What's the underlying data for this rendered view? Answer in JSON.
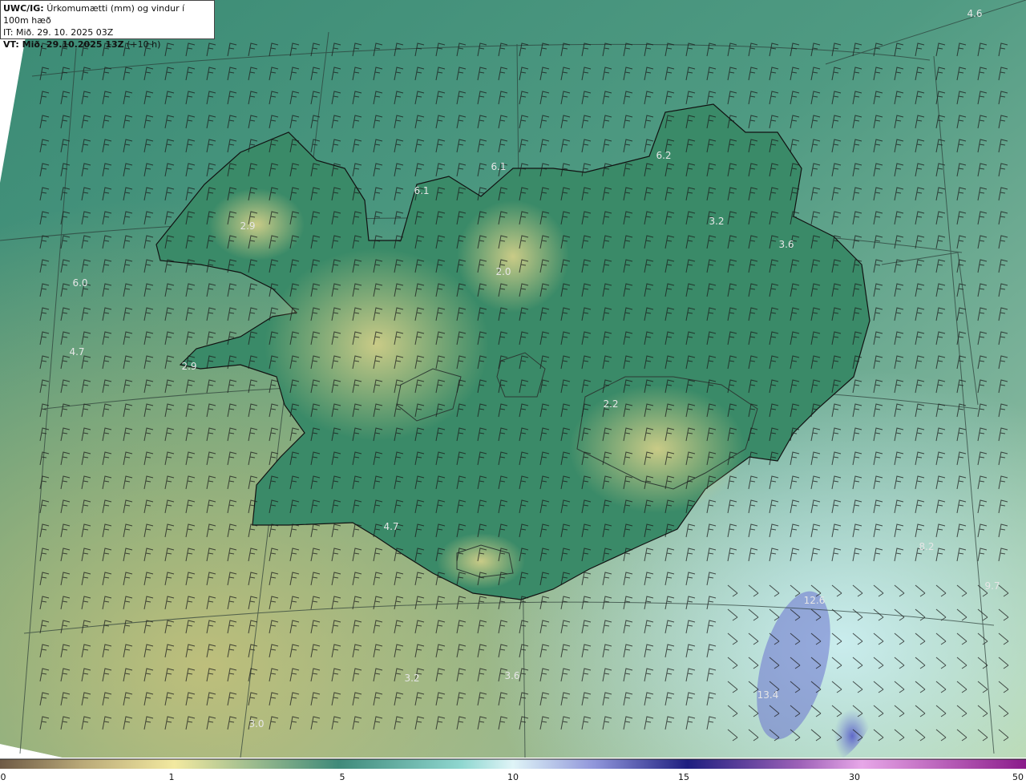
{
  "header": {
    "model": "UWC/IG:",
    "variable": "Úrkomumætti (mm) og vindur í 100m hæð",
    "init_time": "IT: Mið. 29. 10. 2025 03Z",
    "valid_label": "VT: Mið. 29.10.2025 13Z",
    "valid_offset": "(+10 h)"
  },
  "map_labels": [
    {
      "id": "ne-corner",
      "text": "4.6"
    },
    {
      "id": "north-1",
      "text": "6.1"
    },
    {
      "id": "north-2",
      "text": "6.1"
    },
    {
      "id": "north-3",
      "text": "6.2"
    },
    {
      "id": "westfjords",
      "text": "2.9"
    },
    {
      "id": "northeast-1",
      "text": "3.2"
    },
    {
      "id": "northeast-2",
      "text": "3.6"
    },
    {
      "id": "west-sea-1",
      "text": "6.0"
    },
    {
      "id": "west-sea-2",
      "text": "4.7"
    },
    {
      "id": "snaefells",
      "text": "2.9"
    },
    {
      "id": "central-north",
      "text": "2.0"
    },
    {
      "id": "vatnajokull",
      "text": "2.2"
    },
    {
      "id": "south-1",
      "text": "4.7"
    },
    {
      "id": "south-sea-1",
      "text": "3.2"
    },
    {
      "id": "south-sea-2",
      "text": "3.6"
    },
    {
      "id": "sw-sea",
      "text": "3.0"
    },
    {
      "id": "se-sea-1",
      "text": "12.6"
    },
    {
      "id": "se-sea-2",
      "text": "13.4"
    },
    {
      "id": "east-sea-1",
      "text": "9.7"
    },
    {
      "id": "east-sea-2",
      "text": "8.2"
    }
  ],
  "legend": {
    "ticks": [
      "0",
      "1",
      "5",
      "10",
      "15",
      "30",
      "50"
    ],
    "colors": [
      "#6e5a45",
      "#c9b97a",
      "#f2e9a0",
      "#3f8a7a",
      "#8fd7d0",
      "#dff4f7",
      "#7b7fd1",
      "#2a2a8c",
      "#b066b8",
      "#8a1a8a"
    ]
  }
}
